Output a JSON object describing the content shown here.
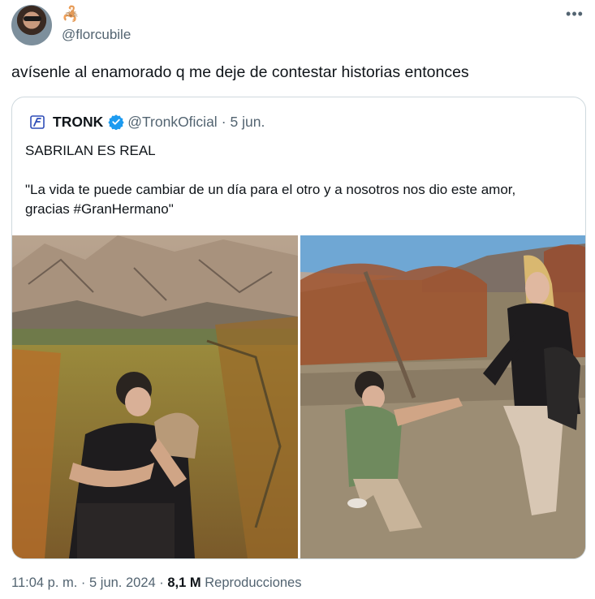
{
  "author": {
    "name_emoji": "🦂",
    "handle": "@florcubile"
  },
  "tweet": {
    "text": "avísenle al enamorado q me deje de contestar historias entonces"
  },
  "quoted": {
    "name": "TRONK",
    "handle": "@TronkOficial",
    "separator": "·",
    "date": "5 jun.",
    "line1": "SABRILAN ES REAL",
    "line2": "\"La vida te puede cambiar de un día para el otro y a nosotros nos dio este amor, gracias #GranHermano\""
  },
  "footer": {
    "time": "11:04 p. m.",
    "separator1": "·",
    "date": "5 jun. 2024",
    "separator2": "·",
    "views_count": "8,1 M",
    "views_label": "Reproducciones"
  },
  "icons": {
    "more": "more-icon",
    "verified": "verified-badge-icon",
    "logo": "tronk-logo-icon"
  },
  "colors": {
    "text": "#0f1419",
    "secondary": "#536471",
    "border": "#cfd9de",
    "verified": "#1d9bf0"
  }
}
